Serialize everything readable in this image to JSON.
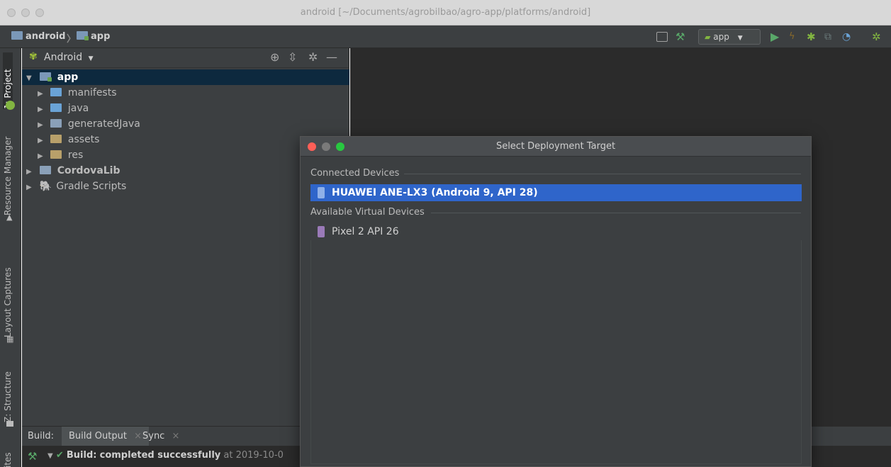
{
  "window": {
    "title": "android [~/Documents/agrobilbao/agro-app/platforms/android]"
  },
  "navbar": {
    "breadcrumb": [
      "android",
      "app"
    ],
    "run_config": "app"
  },
  "left_strip": {
    "tabs": [
      "1: Project",
      "Resource Manager",
      "Layout Captures",
      "Z: Structure",
      "ites"
    ]
  },
  "project_panel": {
    "view_selector": "Android",
    "tree": [
      {
        "label": "app",
        "level": 0,
        "expanded": true,
        "selected": true
      },
      {
        "label": "manifests",
        "level": 1,
        "expanded": false
      },
      {
        "label": "java",
        "level": 1,
        "expanded": false
      },
      {
        "label": "generatedJava",
        "level": 1,
        "expanded": false
      },
      {
        "label": "assets",
        "level": 1,
        "expanded": false
      },
      {
        "label": "res",
        "level": 1,
        "expanded": false
      },
      {
        "label": "CordovaLib",
        "level": 0,
        "expanded": false
      },
      {
        "label": "Gradle Scripts",
        "level": 0,
        "expanded": false
      }
    ]
  },
  "build_panel": {
    "label": "Build:",
    "tabs": [
      "Build Output",
      "Sync"
    ],
    "status_bold": "Build:",
    "status_text": "completed successfully",
    "status_time": "at 2019-10-0"
  },
  "dialog": {
    "title": "Select Deployment Target",
    "connected_header": "Connected Devices",
    "connected_devices": [
      "HUAWEI ANE-LX3 (Android 9, API 28)"
    ],
    "virtual_header": "Available Virtual Devices",
    "virtual_devices": [
      "Pixel 2 API 26"
    ]
  },
  "colors": {
    "selection_blue": "#2f65ca",
    "panel_bg": "#3c3f41",
    "editor_bg": "#2b2b2b",
    "run_green": "#59a869",
    "debug_green": "#82b541",
    "close_red": "#ff5f57",
    "zoom_green": "#28c840"
  }
}
